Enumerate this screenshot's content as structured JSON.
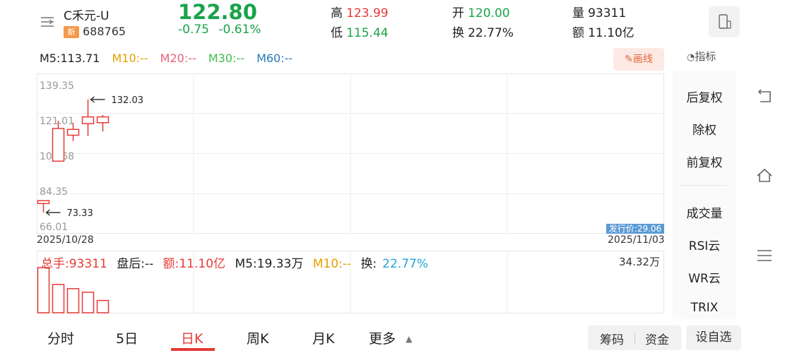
{
  "header": {
    "stock_name": "C禾元-U",
    "badge": "新",
    "stock_code": "688765",
    "price": "122.80",
    "change": "-0.75",
    "change_pct": "-0.61%",
    "high_label": "高",
    "high_value": "123.99",
    "low_label": "低",
    "low_value": "115.44",
    "open_label": "开",
    "open_value": "120.00",
    "turnover_label": "换",
    "turnover_value": "22.77%",
    "volume_label": "量",
    "volume_value": "93311",
    "amount_label": "额",
    "amount_value": "11.10亿"
  },
  "ma": {
    "m5": "M5:113.71",
    "m10": "M10:--",
    "m20": "M20:--",
    "m30": "M30:--",
    "m60": "M60:--",
    "draw_button": "画线",
    "indicator": "指标"
  },
  "chart_data": {
    "type": "candlestick",
    "y_ticks": [
      "139.35",
      "121.01",
      "102.68",
      "84.35",
      "66.01"
    ],
    "ylim": [
      66.01,
      139.35
    ],
    "candles": [
      {
        "open": 78.0,
        "close": 79.5,
        "high": 79.5,
        "low": 73.33
      },
      {
        "open": 100.0,
        "close": 117.0,
        "high": 121.0,
        "low": 100.0
      },
      {
        "open": 113.5,
        "close": 116.5,
        "high": 120.0,
        "low": 110.5
      },
      {
        "open": 123.0,
        "close": 119.5,
        "high": 132.03,
        "low": 113.0
      },
      {
        "open": 123.0,
        "close": 120.0,
        "high": 123.99,
        "low": 115.44
      }
    ],
    "max_label": "132.03",
    "min_label": "73.33",
    "issue_price_label": "发行价:29.06",
    "date_start": "2025/10/28",
    "date_end": "2025/11/03",
    "volume": {
      "values": [
        34.32,
        21.5,
        18.3,
        15.6,
        9.33
      ],
      "max_label": "34.32万"
    }
  },
  "volume_bar": {
    "total": "总手:93311",
    "after_hours": "盘后:--",
    "amount": "额:11.10亿",
    "m5": "M5:19.33万",
    "m10": "M10:--",
    "turnover_label": "换:",
    "turnover_value": "22.77%"
  },
  "side_panel": {
    "items": [
      "后复权",
      "除权",
      "前复权",
      "成交量",
      "RSI云",
      "WR云",
      "TRIX"
    ]
  },
  "tabs": [
    "分时",
    "5日",
    "日K",
    "周K",
    "月K",
    "更多"
  ],
  "buttons": {
    "chips": "筹码",
    "funds": "资金",
    "add_watch": "设自选"
  },
  "colors": {
    "up": "#e53935",
    "down": "#1aa34a",
    "m10": "#e6a100",
    "m20": "#e8607a",
    "m30": "#3cbf4a",
    "m60": "#2a7bb8"
  }
}
